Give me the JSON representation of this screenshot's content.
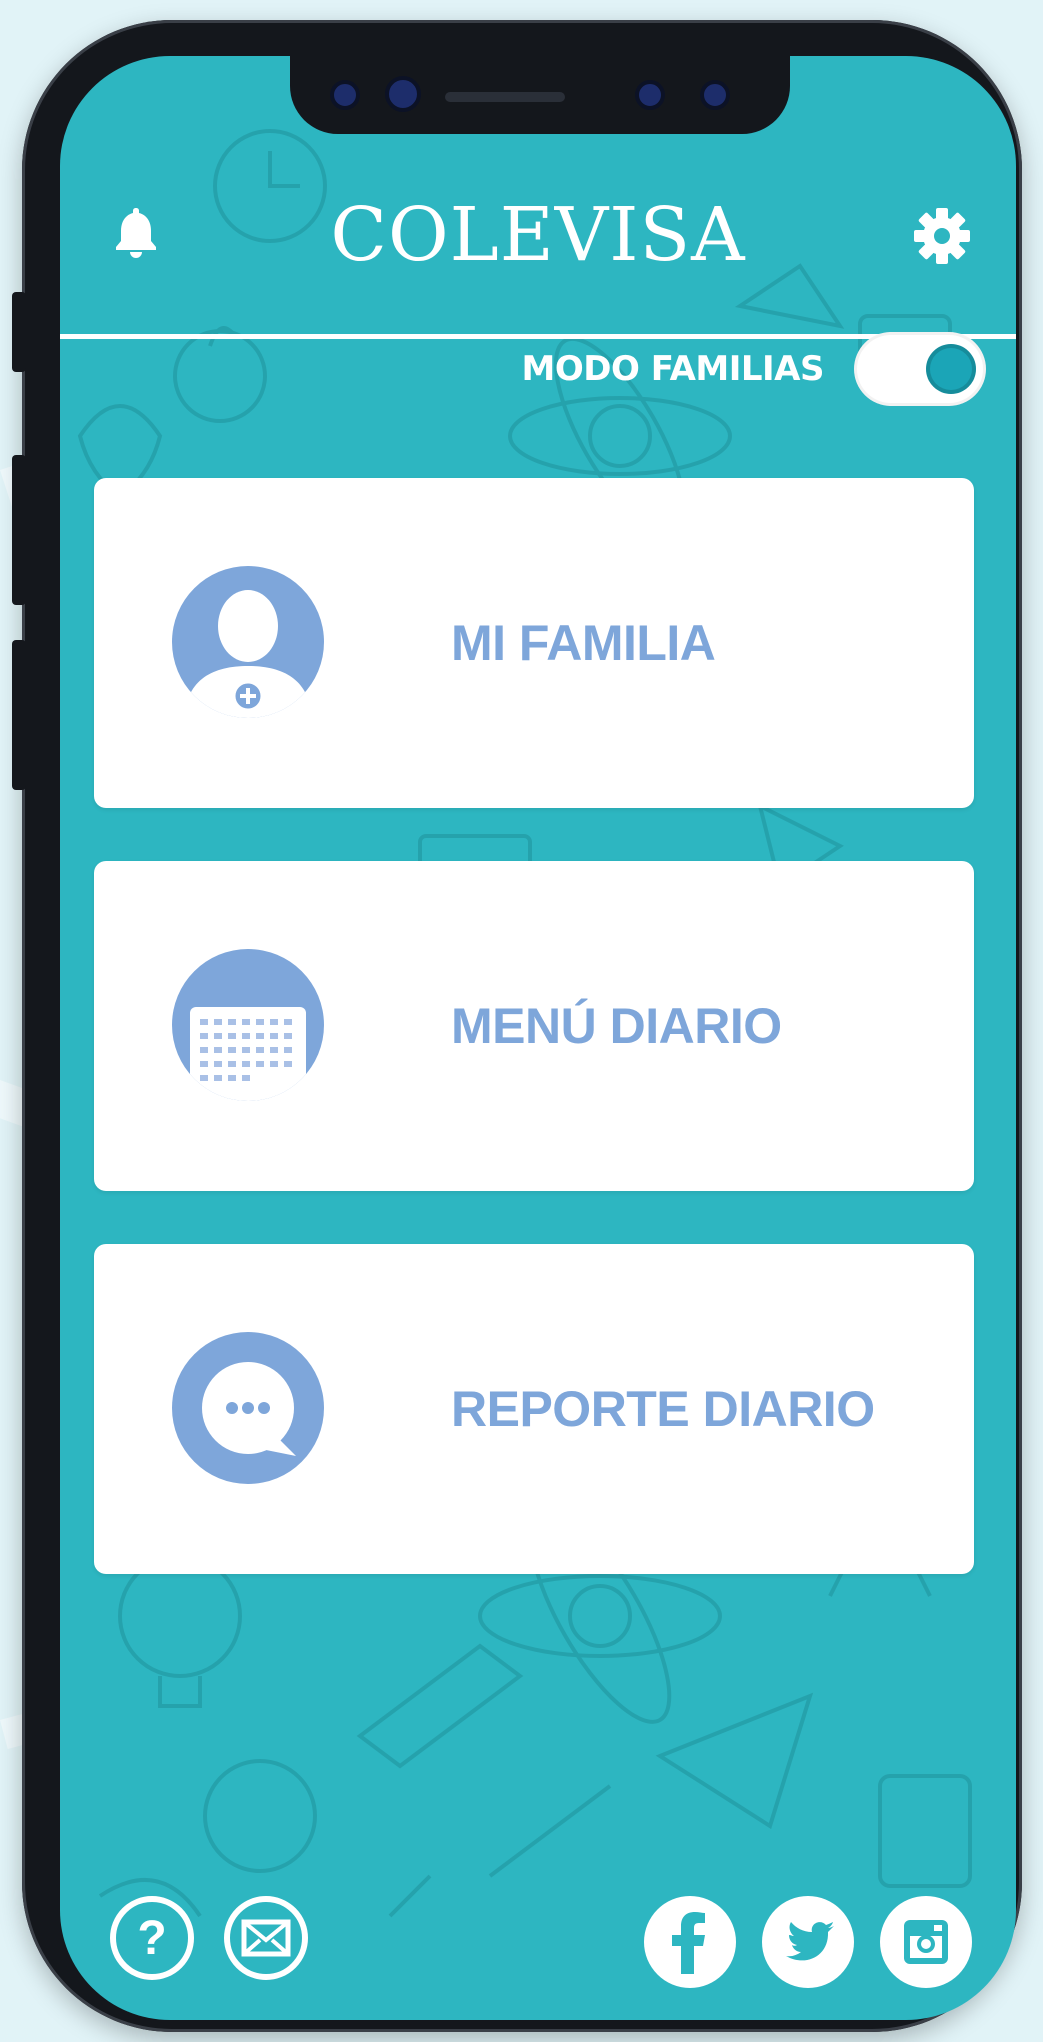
{
  "app": {
    "logo_text": "COLEVISA",
    "mode_label": "MODO FAMILIAS",
    "mode_enabled": true
  },
  "menu": [
    {
      "label": "MI FAMILIA",
      "icon": "person-add-icon"
    },
    {
      "label": "MENÚ DIARIO",
      "icon": "calendar-icon"
    },
    {
      "label": "REPORTE DIARIO",
      "icon": "chat-bubble-icon"
    }
  ],
  "header_icons": {
    "left": "bell-icon",
    "right": "gear-icon"
  },
  "footer_icons": {
    "left": [
      "help-icon",
      "mail-icon"
    ],
    "right": [
      "facebook-icon",
      "twitter-icon",
      "instagram-icon"
    ]
  },
  "colors": {
    "screen_background": "#2db6c1",
    "card_background": "#ffffff",
    "accent_blue": "#7ea6da",
    "toggle_knob": "#1ba5b7",
    "page_background": "#e1f3f7"
  }
}
